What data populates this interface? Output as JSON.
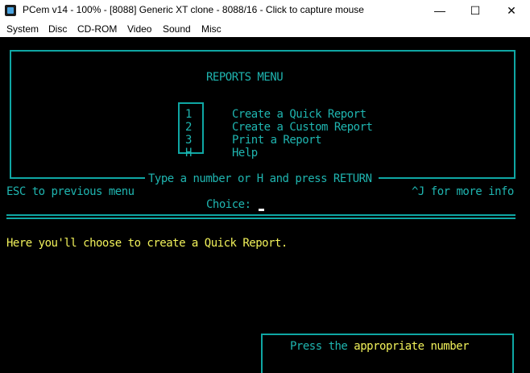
{
  "window": {
    "title": "PCem v14 - 100% - [8088] Generic XT clone - 8088/16 - Click to capture mouse",
    "minimize": "—",
    "maximize": "☐",
    "close": "✕"
  },
  "menu": [
    "System",
    "Disc",
    "CD-ROM",
    "Video",
    "Sound",
    "Misc"
  ],
  "dos": {
    "title": "REPORTS MENU",
    "options": [
      {
        "key": "1",
        "label": "Create a Quick Report"
      },
      {
        "key": "2",
        "label": "Create a Custom Report"
      },
      {
        "key": "3",
        "label": "Print a Report"
      },
      {
        "key": "H",
        "label": "Help"
      }
    ],
    "footer": "Type a number or H and press RETURN",
    "esc_hint": "ESC to previous menu",
    "info_hint": "^J for more info",
    "choice_label": "Choice:",
    "message": "Here you'll choose to create a Quick Report.",
    "bottom_prompt_part1": "Press the ",
    "bottom_prompt_part2": "appropriate number"
  },
  "colors": {
    "screen_bg": "#000000",
    "cyan": "#1fb5b0",
    "yellow": "#f1f15a"
  }
}
